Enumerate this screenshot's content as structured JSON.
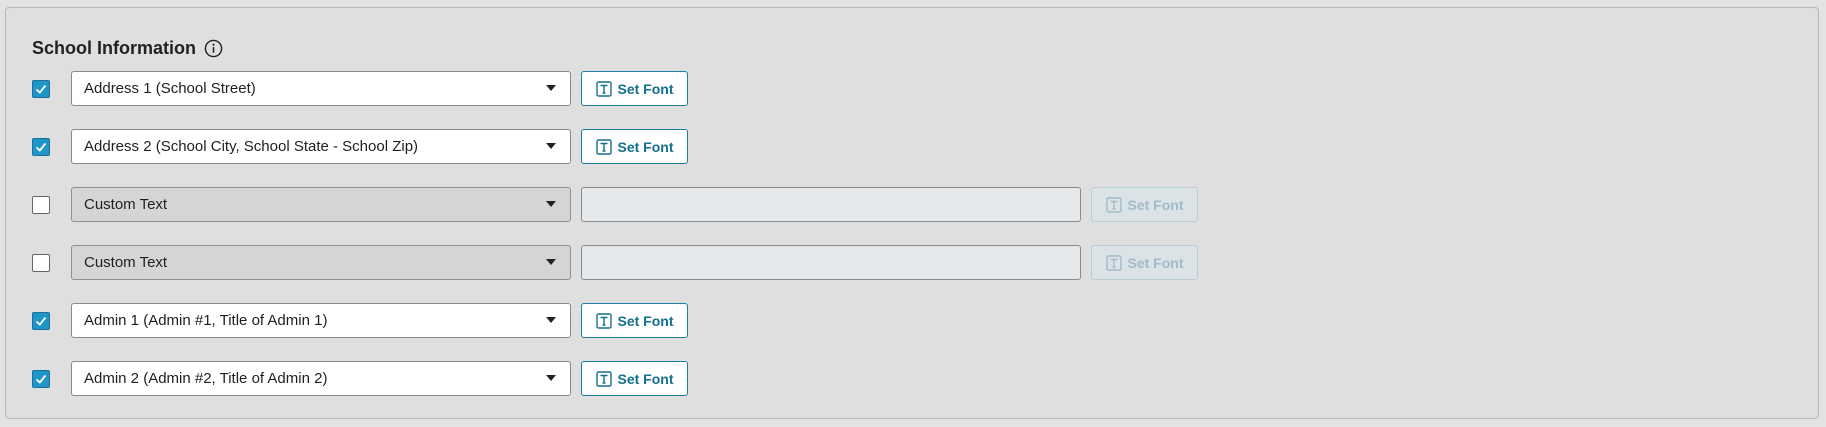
{
  "section": {
    "title": "School Information",
    "info_icon": "info-circle-icon"
  },
  "rows": [
    {
      "checked": true,
      "select_value": "Address 1 (School Street)",
      "disabled": false,
      "font_label": "Set Font"
    },
    {
      "checked": true,
      "select_value": "Address 2 (School City, School State - School Zip)",
      "disabled": false,
      "font_label": "Set Font"
    },
    {
      "checked": false,
      "select_value": "Custom Text",
      "disabled": true,
      "text_value": "",
      "font_label": "Set Font"
    },
    {
      "checked": false,
      "select_value": "Custom Text",
      "disabled": true,
      "text_value": "",
      "font_label": "Set Font"
    },
    {
      "checked": true,
      "select_value": "Admin 1 (Admin #1, Title of Admin 1)",
      "disabled": false,
      "font_label": "Set Font"
    },
    {
      "checked": true,
      "select_value": "Admin 2 (Admin #2, Title of Admin 2)",
      "disabled": false,
      "font_label": "Set Font"
    }
  ],
  "colors": {
    "accent": "#1e96c8",
    "button_text": "#136f8f",
    "panel_bg": "#dfdfdf"
  },
  "icons": {
    "checkbox_check": "checkmark-icon",
    "font": "text-font-icon",
    "dropdown": "chevron-down-icon"
  }
}
